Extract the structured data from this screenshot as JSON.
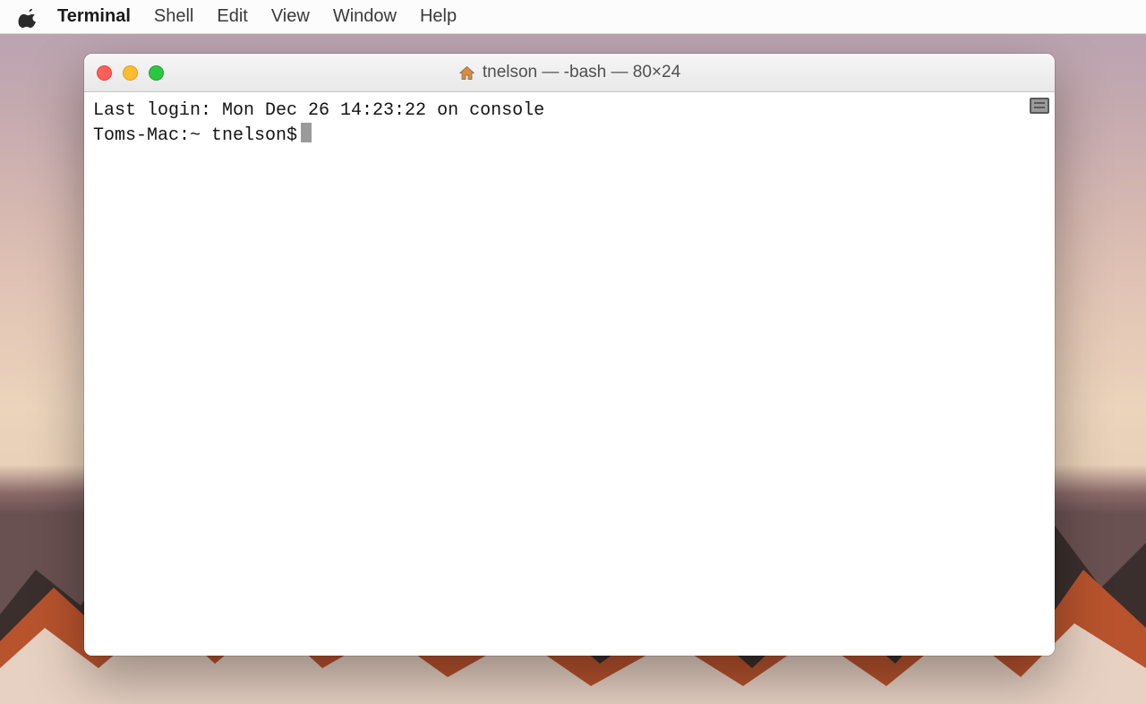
{
  "menubar": {
    "app_name": "Terminal",
    "items": [
      "Shell",
      "Edit",
      "View",
      "Window",
      "Help"
    ]
  },
  "window": {
    "title": "tnelson — -bash — 80×24"
  },
  "terminal": {
    "last_login_line": "Last login: Mon Dec 26 14:23:22 on console",
    "prompt": "Toms-Mac:~ tnelson$"
  }
}
